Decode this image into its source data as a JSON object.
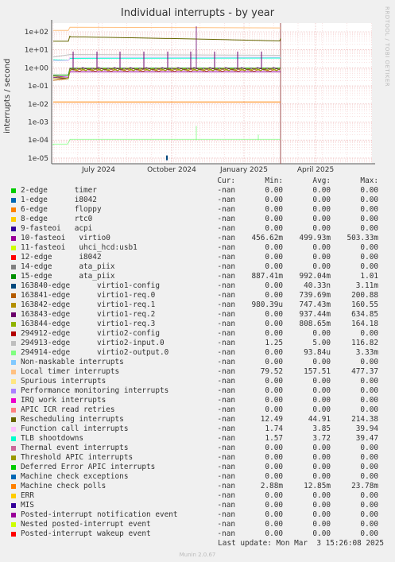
{
  "chart_data": {
    "type": "line",
    "title": "Individual interrupts - by year",
    "ylabel": "interrupts / second",
    "yscale": "log",
    "y_tick_labels": [
      "1e+02",
      "1e+01",
      "1e+00",
      "1e-01",
      "1e-02",
      "1e-03",
      "1e-04",
      "1e-05"
    ],
    "x_tick_labels": [
      "July 2024",
      "October 2024",
      "January 2025",
      "April 2025"
    ],
    "grid": true,
    "legend_headers": [
      "Cur:",
      "Min:",
      "Avg:",
      "Max:"
    ],
    "series": [
      {
        "name": "2-edge      timer",
        "color": "#00cc00",
        "cur": "-nan",
        "min": "0.00",
        "avg": "0.00",
        "max": "0.00"
      },
      {
        "name": "1-edge      i8042",
        "color": "#0066b3",
        "cur": "-nan",
        "min": "0.00",
        "avg": "0.00",
        "max": "0.00"
      },
      {
        "name": "6-edge      floppy",
        "color": "#ff8000",
        "cur": "-nan",
        "min": "0.00",
        "avg": "0.00",
        "max": "0.00"
      },
      {
        "name": "8-edge      rtc0",
        "color": "#ffcc00",
        "cur": "-nan",
        "min": "0.00",
        "avg": "0.00",
        "max": "0.00"
      },
      {
        "name": "9-fasteoi   acpi",
        "color": "#330099",
        "cur": "-nan",
        "min": "0.00",
        "avg": "0.00",
        "max": "0.00"
      },
      {
        "name": "10-fasteoi   virtio0",
        "color": "#990099",
        "cur": "-nan",
        "min": "456.62m",
        "avg": "499.93m",
        "max": "503.33m"
      },
      {
        "name": "11-fasteoi   uhci_hcd:usb1",
        "color": "#ccff00",
        "cur": "-nan",
        "min": "0.00",
        "avg": "0.00",
        "max": "0.00"
      },
      {
        "name": "12-edge      i8042",
        "color": "#ff0000",
        "cur": "-nan",
        "min": "0.00",
        "avg": "0.00",
        "max": "0.00"
      },
      {
        "name": "14-edge      ata_piix",
        "color": "#808080",
        "cur": "-nan",
        "min": "0.00",
        "avg": "0.00",
        "max": "0.00"
      },
      {
        "name": "15-edge      ata_piix",
        "color": "#008f00",
        "cur": "-nan",
        "min": "887.41m",
        "avg": "992.04m",
        "max": "1.01"
      },
      {
        "name": "163840-edge      virtio1-config",
        "color": "#00487d",
        "cur": "-nan",
        "min": "0.00",
        "avg": "40.33n",
        "max": "3.11m"
      },
      {
        "name": "163841-edge      virtio1-req.0",
        "color": "#b35a00",
        "cur": "-nan",
        "min": "0.00",
        "avg": "739.69m",
        "max": "200.88"
      },
      {
        "name": "163842-edge      virtio1-req.1",
        "color": "#b38f00",
        "cur": "-nan",
        "min": "980.39u",
        "avg": "747.43m",
        "max": "160.55"
      },
      {
        "name": "163843-edge      virtio1-req.2",
        "color": "#6b006b",
        "cur": "-nan",
        "min": "0.00",
        "avg": "937.44m",
        "max": "634.85"
      },
      {
        "name": "163844-edge      virtio1-req.3",
        "color": "#8fb300",
        "cur": "-nan",
        "min": "0.00",
        "avg": "808.65m",
        "max": "164.18"
      },
      {
        "name": "294912-edge      virtio2-config",
        "color": "#b30000",
        "cur": "-nan",
        "min": "0.00",
        "avg": "0.00",
        "max": "0.00"
      },
      {
        "name": "294913-edge      virtio2-input.0",
        "color": "#bebebe",
        "cur": "-nan",
        "min": "1.25",
        "avg": "5.00",
        "max": "116.82"
      },
      {
        "name": "294914-edge      virtio2-output.0",
        "color": "#80ff80",
        "cur": "-nan",
        "min": "0.00",
        "avg": "93.84u",
        "max": "3.33m"
      },
      {
        "name": "Non-maskable interrupts",
        "color": "#80c9ff",
        "cur": "-nan",
        "min": "0.00",
        "avg": "0.00",
        "max": "0.00"
      },
      {
        "name": "Local timer interrupts",
        "color": "#ffc080",
        "cur": "-nan",
        "min": "79.52",
        "avg": "157.51",
        "max": "477.37"
      },
      {
        "name": "Spurious interrupts",
        "color": "#ffe680",
        "cur": "-nan",
        "min": "0.00",
        "avg": "0.00",
        "max": "0.00"
      },
      {
        "name": "Performance monitoring interrupts",
        "color": "#aa80ff",
        "cur": "-nan",
        "min": "0.00",
        "avg": "0.00",
        "max": "0.00"
      },
      {
        "name": "IRQ work interrupts",
        "color": "#ee00cc",
        "cur": "-nan",
        "min": "0.00",
        "avg": "0.00",
        "max": "0.00"
      },
      {
        "name": "APIC ICR read retries",
        "color": "#ff8080",
        "cur": "-nan",
        "min": "0.00",
        "avg": "0.00",
        "max": "0.00"
      },
      {
        "name": "Rescheduling interrupts",
        "color": "#666600",
        "cur": "-nan",
        "min": "12.49",
        "avg": "44.91",
        "max": "214.38"
      },
      {
        "name": "Function call interrupts",
        "color": "#ffbfff",
        "cur": "-nan",
        "min": "1.74",
        "avg": "3.85",
        "max": "39.94"
      },
      {
        "name": "TLB shootdowns",
        "color": "#00ffcc",
        "cur": "-nan",
        "min": "1.57",
        "avg": "3.72",
        "max": "39.47"
      },
      {
        "name": "Thermal event interrupts",
        "color": "#cc6699",
        "cur": "-nan",
        "min": "0.00",
        "avg": "0.00",
        "max": "0.00"
      },
      {
        "name": "Threshold APIC interrupts",
        "color": "#999900",
        "cur": "-nan",
        "min": "0.00",
        "avg": "0.00",
        "max": "0.00"
      },
      {
        "name": "Deferred Error APIC interrupts",
        "color": "#00cc00",
        "cur": "-nan",
        "min": "0.00",
        "avg": "0.00",
        "max": "0.00"
      },
      {
        "name": "Machine check exceptions",
        "color": "#0066b3",
        "cur": "-nan",
        "min": "0.00",
        "avg": "0.00",
        "max": "0.00"
      },
      {
        "name": "Machine check polls",
        "color": "#ff8000",
        "cur": "-nan",
        "min": "2.88m",
        "avg": "12.85m",
        "max": "23.78m"
      },
      {
        "name": "ERR",
        "color": "#ffcc00",
        "cur": "-nan",
        "min": "0.00",
        "avg": "0.00",
        "max": "0.00"
      },
      {
        "name": "MIS",
        "color": "#330099",
        "cur": "-nan",
        "min": "0.00",
        "avg": "0.00",
        "max": "0.00"
      },
      {
        "name": "Posted-interrupt notification event",
        "color": "#990099",
        "cur": "-nan",
        "min": "0.00",
        "avg": "0.00",
        "max": "0.00"
      },
      {
        "name": "Nested posted-interrupt event",
        "color": "#ccff00",
        "cur": "-nan",
        "min": "0.00",
        "avg": "0.00",
        "max": "0.00"
      },
      {
        "name": "Posted-interrupt wakeup event",
        "color": "#ff0000",
        "cur": "-nan",
        "min": "0.00",
        "avg": "0.00",
        "max": "0.00"
      }
    ]
  },
  "side_text": "RRDTOOL / TOBI OETIKER",
  "last_update": "Last update: Mon Mar  3 15:26:08 2025",
  "footer": "Munin 2.0.67"
}
